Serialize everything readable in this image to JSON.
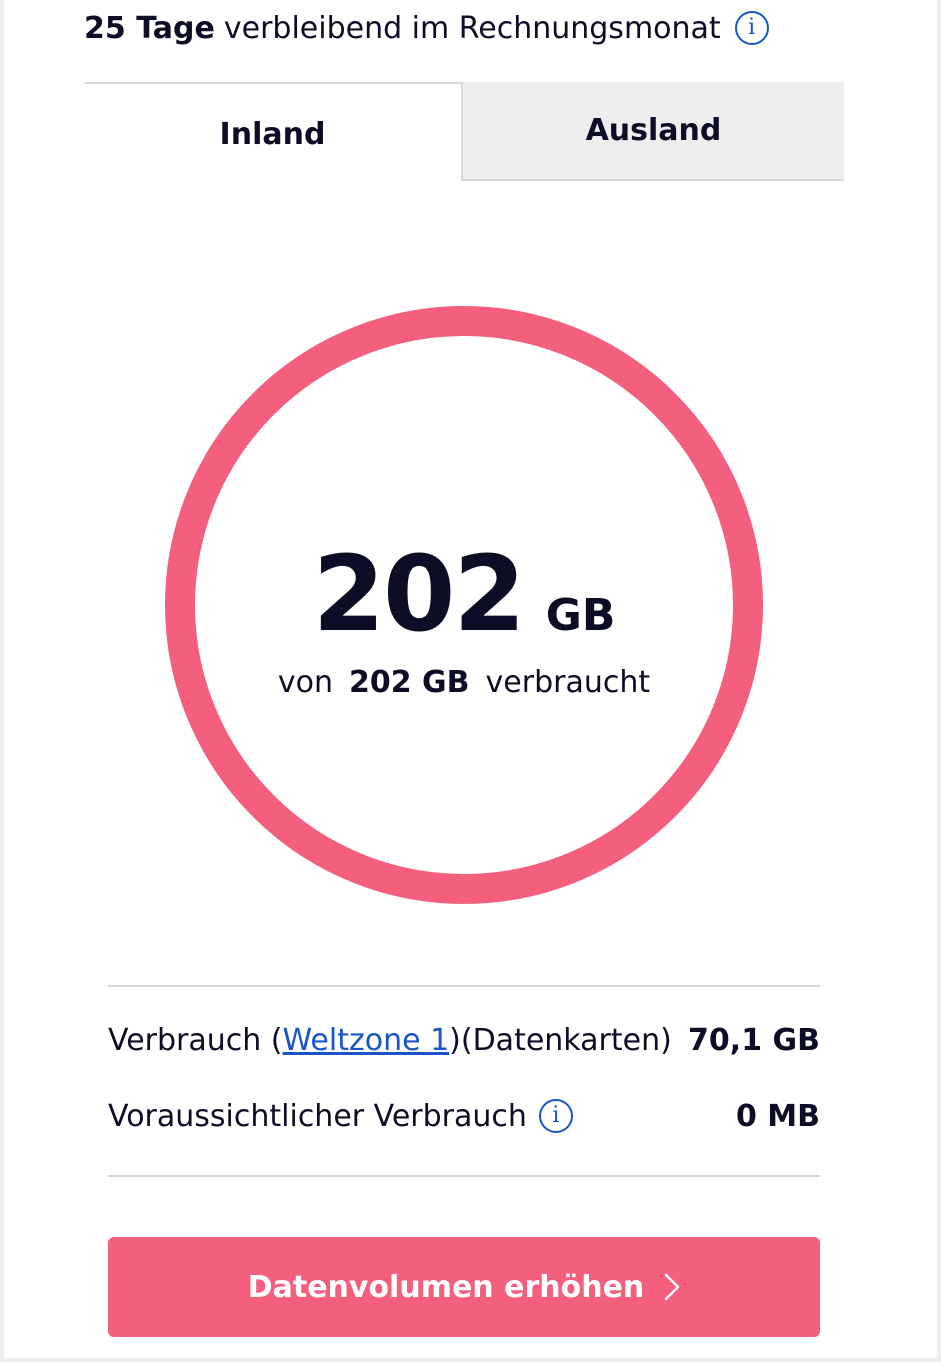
{
  "header": {
    "days_bold": "25 Tage",
    "days_text": "verbleibend im Rechnungsmonat",
    "info_icon": "info-icon"
  },
  "tabs": [
    {
      "label": "Inland",
      "active": true
    },
    {
      "label": "Ausland",
      "active": false
    }
  ],
  "usage": {
    "used_value": "202",
    "used_unit": "GB",
    "prefix": "von",
    "total": "202 GB",
    "suffix": "verbraucht",
    "ring_fill_fraction": 1.0,
    "ring_color": "#f35f7d"
  },
  "details": {
    "row1": {
      "label_start": "Verbrauch (",
      "link": "Weltzone 1",
      "label_end": ")(Datenkarten)",
      "value": "70,1 GB"
    },
    "row2": {
      "label": "Voraussichtlicher Verbrauch",
      "info_icon": "info-icon",
      "value": "0 MB"
    }
  },
  "cta": {
    "label": "Datenvolumen erhöhen",
    "icon": "chevron-right-icon",
    "color": "#f35f7d"
  },
  "colors": {
    "text": "#0d0d26",
    "link": "#1a55c7",
    "accent": "#f35f7d"
  }
}
